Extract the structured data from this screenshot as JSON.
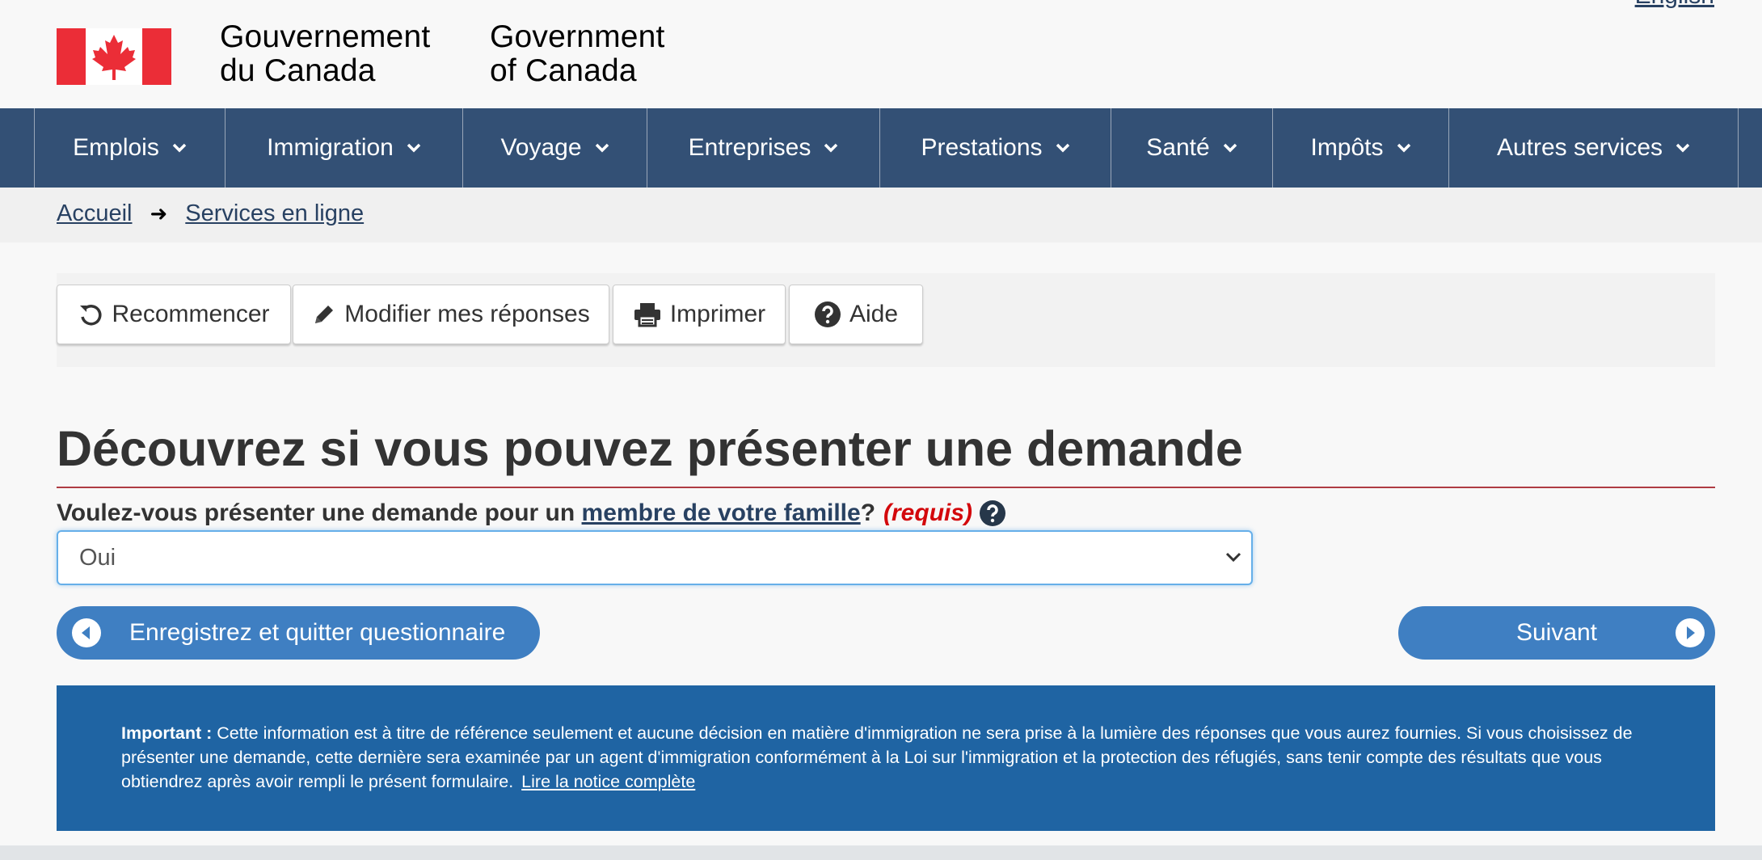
{
  "header": {
    "signature_fr_line1": "Gouvernement",
    "signature_fr_line2": "du Canada",
    "signature_en_line1": "Government",
    "signature_en_line2": "of Canada",
    "language_link": "English",
    "flag_icon": "canada-flag-icon"
  },
  "menu": {
    "items": [
      {
        "label": "Emplois"
      },
      {
        "label": "Immigration"
      },
      {
        "label": "Voyage"
      },
      {
        "label": "Entreprises"
      },
      {
        "label": "Prestations"
      },
      {
        "label": "Santé"
      },
      {
        "label": "Impôts"
      },
      {
        "label": "Autres services"
      }
    ],
    "background_color": "#335075"
  },
  "breadcrumb": {
    "items": [
      {
        "label": "Accueil"
      },
      {
        "label": "Services en ligne"
      }
    ],
    "separator": "➜"
  },
  "toolbar": {
    "restart_label": "Recommencer",
    "edit_label": "Modifier mes réponses",
    "print_label": "Imprimer",
    "help_label": "Aide"
  },
  "main": {
    "title": "Découvrez si vous pouvez présenter une demande",
    "question": {
      "text_before": "Voulez-vous présenter une demande pour un ",
      "link_text": "membre de votre famille",
      "text_after": "?",
      "required_label": "(requis)"
    },
    "select": {
      "selected_value": "Oui"
    },
    "save_button_label": "Enregistrez et quitter questionnaire",
    "next_button_label": "Suivant",
    "accent_color": "#3f7fc2"
  },
  "notice": {
    "important_label": "Important :",
    "text": " Cette information est à titre de référence seulement et aucune décision en matière d'immigration ne sera prise à la lumière des réponses que vous aurez fournies. Si vous choisissez de présenter une demande, cette dernière sera examinée par un agent d'immigration conformément à la Loi sur l'immigration et la protection des réfugiés, sans tenir compte des résultats que vous obtiendrez après avoir rempli le présent formulaire.",
    "link_text": "Lire la notice complète",
    "background_color": "#1f64a3"
  }
}
